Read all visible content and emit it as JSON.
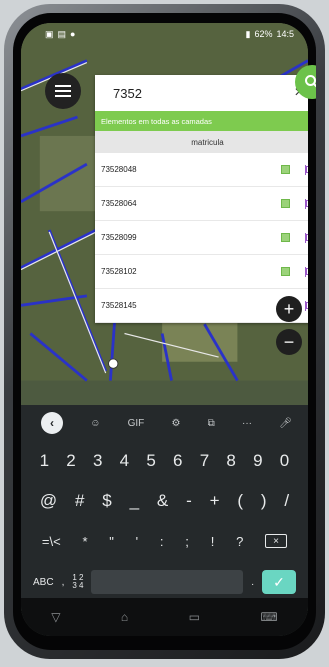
{
  "status": {
    "time": "14:5",
    "battery": "62%"
  },
  "search": {
    "query": "7352",
    "clear": "×"
  },
  "results": {
    "header": "Elementos em todas as camadas",
    "column": "matricula",
    "rows": [
      {
        "value": "73528048"
      },
      {
        "value": "73528064"
      },
      {
        "value": "73528099"
      },
      {
        "value": "73528102"
      },
      {
        "value": "73528145"
      }
    ]
  },
  "zoom": {
    "in": "+",
    "out": "−"
  },
  "keyboard": {
    "toolbar": {
      "back": "‹",
      "gif": "GIF",
      "more": "···"
    },
    "row1": [
      "1",
      "2",
      "3",
      "4",
      "5",
      "6",
      "7",
      "8",
      "9",
      "0"
    ],
    "row2": [
      "@",
      "#",
      "$",
      "_",
      "&",
      "-",
      "+",
      "(",
      ")",
      "/"
    ],
    "row3": [
      "=\\<",
      "*",
      "\"",
      "'",
      ":",
      ";",
      "!",
      "?"
    ],
    "abc": "ABC",
    "comma": ",",
    "numkey": "1 2\n3 4",
    "period": ".",
    "enter": "✓"
  },
  "colors": {
    "accent": "#6cc24a",
    "result_bar": "#7ecb4f",
    "flag": "#9b58c8",
    "enter": "#6ad6c2"
  }
}
